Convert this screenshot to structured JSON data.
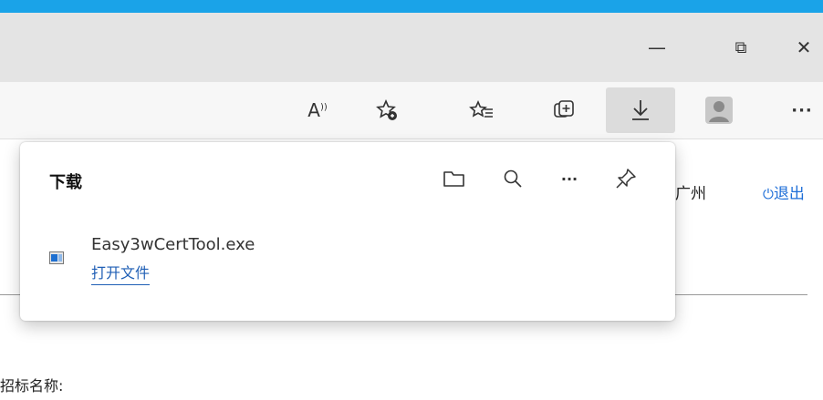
{
  "window": {
    "minimize_glyph": "—",
    "restore_glyph": "⧉",
    "close_glyph": "✕"
  },
  "toolbar": {
    "read_aloud_text": "A",
    "more_glyph": "···",
    "icons": [
      "read-aloud-icon",
      "favorite-add-icon",
      "favorites-icon",
      "collections-icon",
      "download-icon",
      "profile-icon",
      "more-icon"
    ]
  },
  "downloads": {
    "title": "下载",
    "actions": [
      "folder-icon",
      "search-icon",
      "more-icon",
      "pin-icon"
    ],
    "more_glyph": "···",
    "item": {
      "file_name": "Easy3wCertTool.exe",
      "open_link": "打开文件"
    }
  },
  "page": {
    "city_text": "广州",
    "logout_text": "退出",
    "bottom_label": "招标名称:"
  },
  "colors": {
    "accent_strip": "#1aa3e8",
    "link": "#1f5fb5",
    "logout": "#1f6fd8"
  }
}
